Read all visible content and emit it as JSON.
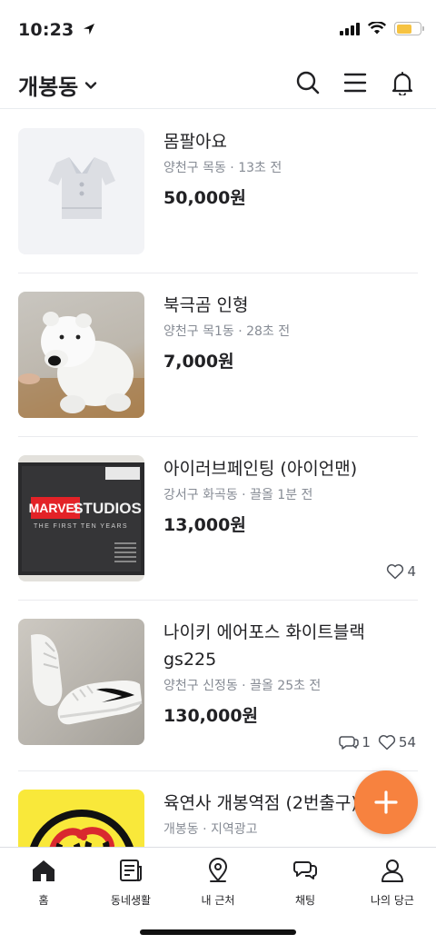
{
  "status_bar": {
    "time": "10:23"
  },
  "header": {
    "location": "개봉동"
  },
  "items": [
    {
      "title": "몸팔아요",
      "meta": "양천구 목동 · 13초 전",
      "price": "50,000원"
    },
    {
      "title": "북극곰 인형",
      "meta": "양천구 목1동 · 28초 전",
      "price": "7,000원"
    },
    {
      "title": "아이러브페인팅 (아이언맨)",
      "meta": "강서구 화곡동 · 끌올 1분 전",
      "price": "13,000원",
      "likes": "4",
      "thumb_text": {
        "brand1": "MARVEL",
        "brand2": "STUDIOS",
        "sub": "THE FIRST TEN YEARS"
      }
    },
    {
      "title": "나이키 에어포스 화이트블랙 gs225",
      "meta": "양천구 신정동 · 끌올 25초 전",
      "price": "130,000원",
      "chats": "1",
      "likes": "54"
    },
    {
      "title": "육연사 개봉역점 (2번출구)",
      "meta": "개봉동 · 지역광고"
    }
  ],
  "tabs": [
    {
      "label": "홈"
    },
    {
      "label": "동네생활"
    },
    {
      "label": "내 근처"
    },
    {
      "label": "채팅"
    },
    {
      "label": "나의 당근"
    }
  ],
  "colors": {
    "accent": "#f7823f",
    "meta_gray": "#868b94"
  }
}
